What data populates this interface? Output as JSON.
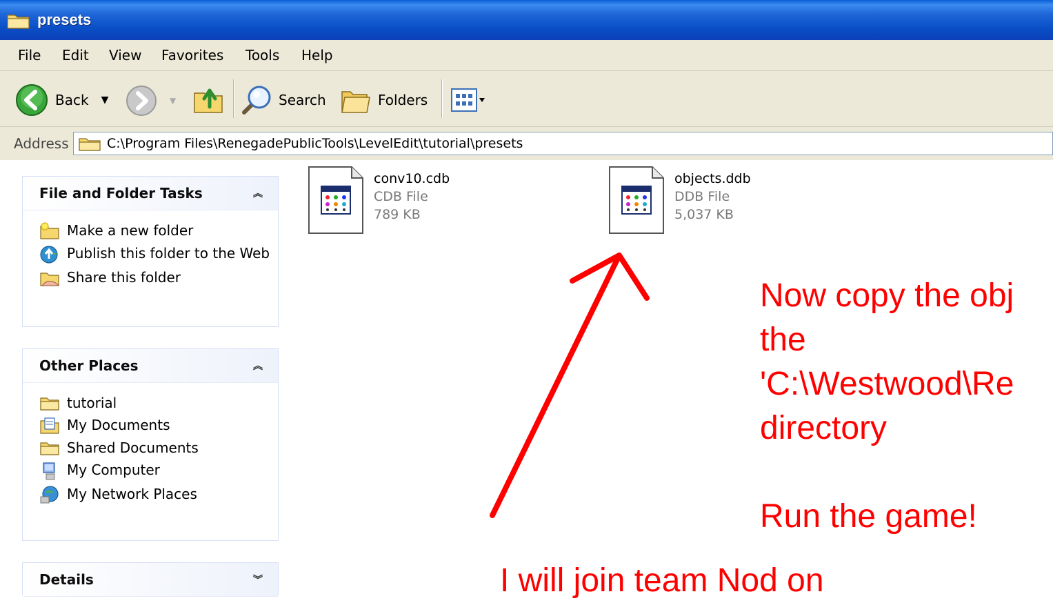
{
  "window": {
    "title": "presets"
  },
  "menu": [
    "File",
    "Edit",
    "View",
    "Favorites",
    "Tools",
    "Help"
  ],
  "toolbar": {
    "back_label": "Back",
    "search_label": "Search",
    "folders_label": "Folders"
  },
  "address": {
    "label": "Address",
    "path": "C:\\Program Files\\RenegadePublicTools\\LevelEdit\\tutorial\\presets"
  },
  "tasks_panel": {
    "title": "File and Folder Tasks",
    "items": [
      "Make a new folder",
      "Publish this folder to the Web",
      "Share this folder"
    ]
  },
  "places_panel": {
    "title": "Other Places",
    "items": [
      "tutorial",
      "My Documents",
      "Shared Documents",
      "My Computer",
      "My Network Places"
    ]
  },
  "details_panel": {
    "title": "Details"
  },
  "files": [
    {
      "name": "conv10.cdb",
      "type": "CDB File",
      "size": "789 KB"
    },
    {
      "name": "objects.ddb",
      "type": "DDB File",
      "size": "5,037 KB"
    }
  ],
  "annotation": {
    "lines": [
      "Now copy the obj",
      "the",
      "'C:\\Westwood\\Re",
      "directory",
      "",
      "Run the game!"
    ],
    "bottom": "I will join team Nod on",
    "color": "#ff0000"
  }
}
